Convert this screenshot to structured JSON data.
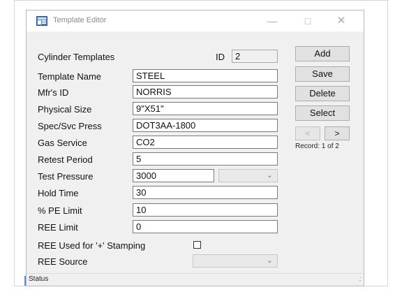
{
  "window": {
    "title": "Template Editor"
  },
  "header": {
    "section_label": "Cylinder Templates",
    "id_label": "ID",
    "id_value": "2"
  },
  "fields": {
    "template_name": {
      "label": "Template Name",
      "value": "STEEL"
    },
    "mfr_id": {
      "label": "Mfr's ID",
      "value": "NORRIS"
    },
    "physical_size": {
      "label": "Physical Size",
      "value": "9\"X51\""
    },
    "spec_svc_press": {
      "label": "Spec/Svc Press",
      "value": "DOT3AA-1800"
    },
    "gas_service": {
      "label": "Gas Service",
      "value": "CO2"
    },
    "retest_period": {
      "label": "Retest Period",
      "value": "5"
    },
    "test_pressure": {
      "label": "Test Pressure",
      "value": "3000",
      "unit_value": ""
    },
    "hold_time": {
      "label": "Hold Time",
      "value": "30"
    },
    "pe_limit": {
      "label": "% PE Limit",
      "value": "10"
    },
    "ree_limit": {
      "label": "REE Limit",
      "value": "0"
    },
    "ree_used": {
      "label": "REE Used for '+' Stamping",
      "checked": false
    },
    "ree_source": {
      "label": "REE Source",
      "value": ""
    }
  },
  "buttons": {
    "add": "Add",
    "save": "Save",
    "delete": "Delete",
    "select": "Select",
    "prev": "<",
    "next": ">"
  },
  "record": {
    "text": "Record: 1 of 2"
  },
  "status": {
    "text": "Status"
  }
}
